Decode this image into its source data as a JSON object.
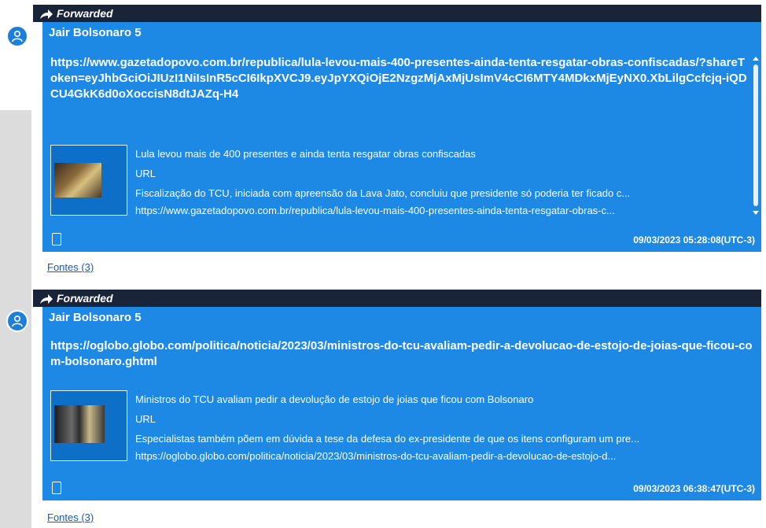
{
  "messages": [
    {
      "forwarded_label": "Forwarded",
      "sender": "Jair Bolsonaro 5",
      "url": "https://www.gazetadopovo.com.br/republica/lula-levou-mais-400-presentes-ainda-tenta-resgatar-obras-confiscadas/?shareToken=eyJhbGciOiJIUzI1NiIsInR5cCI6IkpXVCJ9.eyJpYXQiOjE2NzgzMjAxMjUsImV4cCI6MTY4MDkxMjEyNX0.XbLilgCcfcjq-iQDCU4GkK6d0oXoccisN8dtJAZq-H4",
      "preview": {
        "title": "Lula levou mais de 400 presentes e ainda tenta resgatar obras confiscadas",
        "type": "URL",
        "description": "Fiscalização do TCU, iniciada com apreensão da Lava Jato, concluiu que presidente só poderia ter ficado c...",
        "link": "https://www.gazetadopovo.com.br/republica/lula-levou-mais-400-presentes-ainda-tenta-resgatar-obras-c..."
      },
      "timestamp": "09/03/2023 05:28:08(UTC-3)",
      "sources": "Fontes (3)"
    },
    {
      "forwarded_label": "Forwarded",
      "sender": "Jair Bolsonaro 5",
      "url": "https://oglobo.globo.com/politica/noticia/2023/03/ministros-do-tcu-avaliam-pedir-a-devolucao-de-estojo-de-joias-que-ficou-com-bolsonaro.ghtml",
      "preview": {
        "title": "Ministros do TCU avaliam pedir a devolução de estojo de joias que ficou com Bolsonaro",
        "type": "URL",
        "description": "Especialistas também põem em dúvida a tese da defesa do ex-presidente de que os itens configuram um pre...",
        "link": "https://oglobo.globo.com/politica/noticia/2023/03/ministros-do-tcu-avaliam-pedir-a-devolucao-de-estojo-d..."
      },
      "timestamp": "09/03/2023 06:38:47(UTC-3)",
      "sources": "Fontes (3)"
    }
  ],
  "colors": {
    "bubble": "#1e88e5",
    "forward_bar": "#1a2438",
    "link": "#1a56c2"
  }
}
